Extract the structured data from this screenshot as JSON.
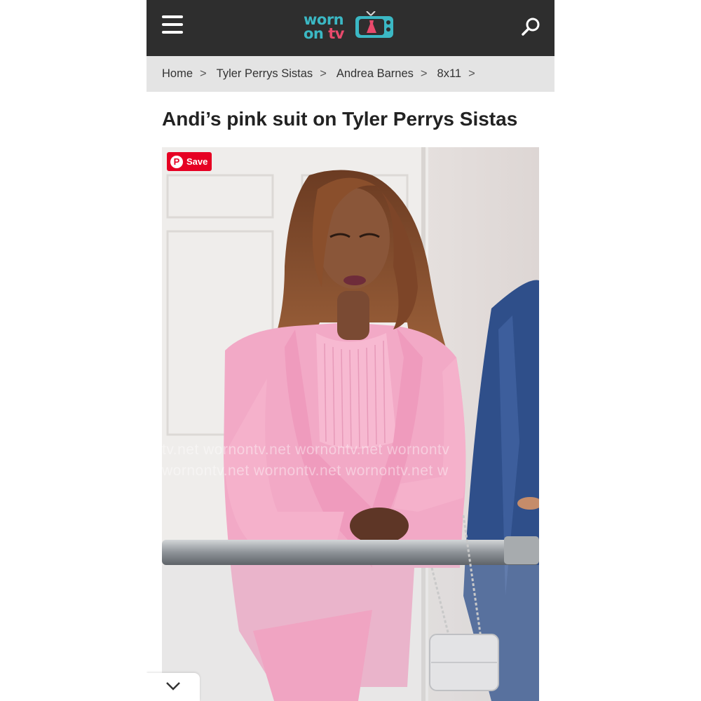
{
  "header": {
    "logo_line1": "worn",
    "logo_line2_a": "on ",
    "logo_line2_b": "tv",
    "colors": {
      "bar": "#2e2e2e",
      "teal": "#3bb8c4",
      "pink": "#e94a6c"
    },
    "icons": {
      "menu": "hamburger-menu-icon",
      "search": "search-icon",
      "logo": "tv-dress-icon"
    }
  },
  "breadcrumb": {
    "items": [
      "Home",
      "Tyler Perrys Sistas",
      "Andrea Barnes",
      "8x11"
    ],
    "separator": ">"
  },
  "article": {
    "title": "Andi’s pink suit on Tyler Perrys Sistas"
  },
  "photo": {
    "save_label": "Save",
    "watermark_line1": "tv.net wornontv.net wornontv.net wornontv",
    "watermark_line2": "wornontv.net wornontv.net wornontv.net w"
  },
  "footer": {
    "collapse_icon": "chevron-down-icon"
  }
}
